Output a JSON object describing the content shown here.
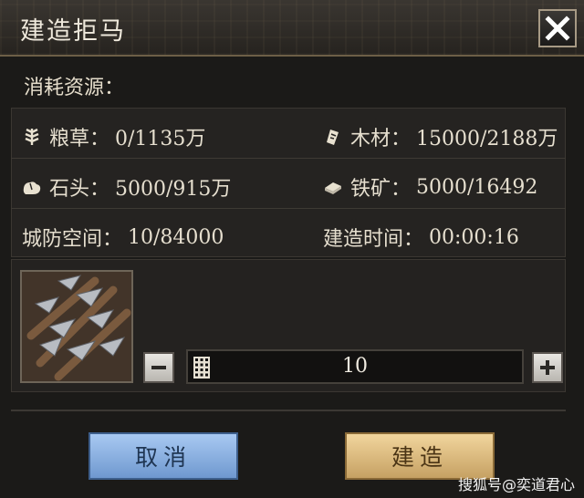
{
  "dialog": {
    "title": "建造拒马",
    "close_icon": "close-icon"
  },
  "resources": {
    "label": "消耗资源：",
    "grain": {
      "label": "粮草：",
      "value": "0/1135万",
      "icon": "grain-icon"
    },
    "wood": {
      "label": "木材：",
      "value": "15000/2188万",
      "icon": "wood-icon"
    },
    "stone": {
      "label": "石头：",
      "value": "5000/915万",
      "icon": "stone-icon"
    },
    "iron": {
      "label": "铁矿：",
      "value": "5000/16492",
      "icon": "iron-ore-icon"
    },
    "defense_space": {
      "label": "城防空间：",
      "value": "10/84000"
    },
    "build_time": {
      "label": "建造时间：",
      "value": "00:00:16"
    }
  },
  "quantity": {
    "value": "10",
    "minus_icon": "minus-icon",
    "plus_icon": "plus-icon",
    "keypad_icon": "keypad-icon"
  },
  "buttons": {
    "cancel": "取消",
    "build": "建造"
  },
  "colors": {
    "cancel_button": "#8fb5e6",
    "build_button": "#e3c286",
    "panel_bg": "#252321"
  },
  "watermark": "搜狐号@奕道君心"
}
